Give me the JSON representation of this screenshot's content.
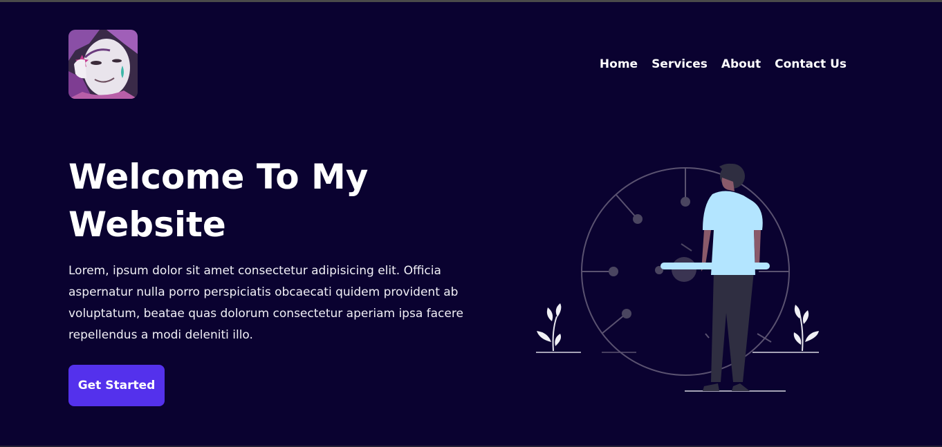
{
  "header": {
    "logo_icon": "anime-avatar-logo",
    "nav": [
      {
        "label": "Home"
      },
      {
        "label": "Services"
      },
      {
        "label": "About"
      },
      {
        "label": "Contact Us"
      }
    ]
  },
  "hero": {
    "title": "Welcome To My Website",
    "text": "Lorem, ipsum dolor sit amet consectetur adipisicing elit. Officia aspernatur nulla porro perspiciatis obcaecati quidem provident ab voluptatum, beatae quas dolorum consectetur aperiam ipsa facere repellendus a modi deleniti illo.",
    "button_label": "Get Started",
    "illustration_icon": "person-with-clock-illustration"
  },
  "colors": {
    "background": "#0a0230",
    "accent": "#5431ec",
    "shirt": "#b3e5ff"
  }
}
